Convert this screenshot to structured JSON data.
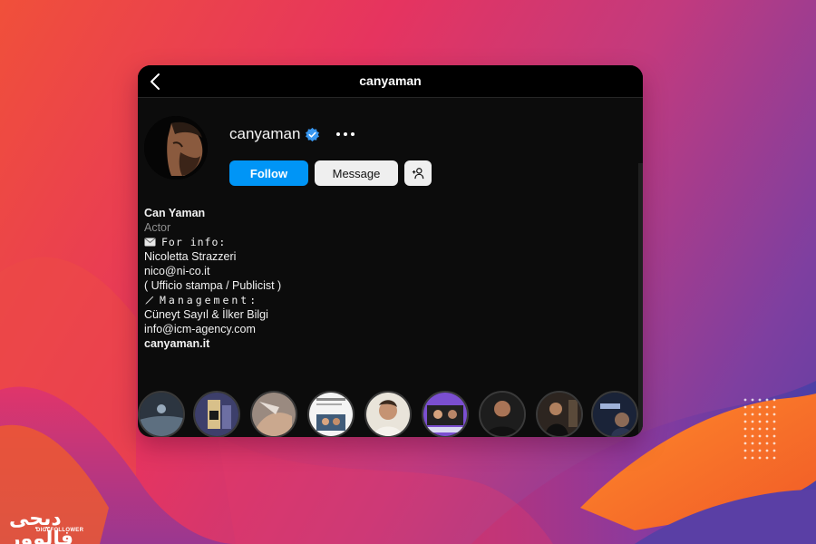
{
  "topbar": {
    "title": "canyaman"
  },
  "profile": {
    "username": "canyaman",
    "follow_label": "Follow",
    "message_label": "Message"
  },
  "bio": {
    "name": "Can Yaman",
    "category": "Actor",
    "info_heading": "𝙵𝚘𝚛 𝚒𝚗𝚏𝚘:",
    "publicist_name": "Nicoletta Strazzeri",
    "publicist_email": "nico@ni-co.it",
    "publicist_role": "( Ufficio stampa / Publicist )",
    "management_heading": "𝙼𝚊𝚗𝚊𝚐𝚎𝚖𝚎𝚗𝚝:",
    "management_names": "Cüneyt Sayıl & İlker Bilgi",
    "management_email": "info@icm-agency.com",
    "website": "canyaman.it"
  },
  "colors": {
    "follow": "#0095f6",
    "verified": "#3897f0",
    "card_bg": "#0c0c0c"
  },
  "icons": [
    "back-chevron-icon",
    "verified-badge-icon",
    "more-options-icon",
    "add-user-icon",
    "envelope-icon",
    "pen-icon"
  ],
  "highlights_count": 9,
  "watermark": {
    "logo_text": "دیجی فالوور",
    "logo_sub": "DIGI FOLLOWER"
  }
}
